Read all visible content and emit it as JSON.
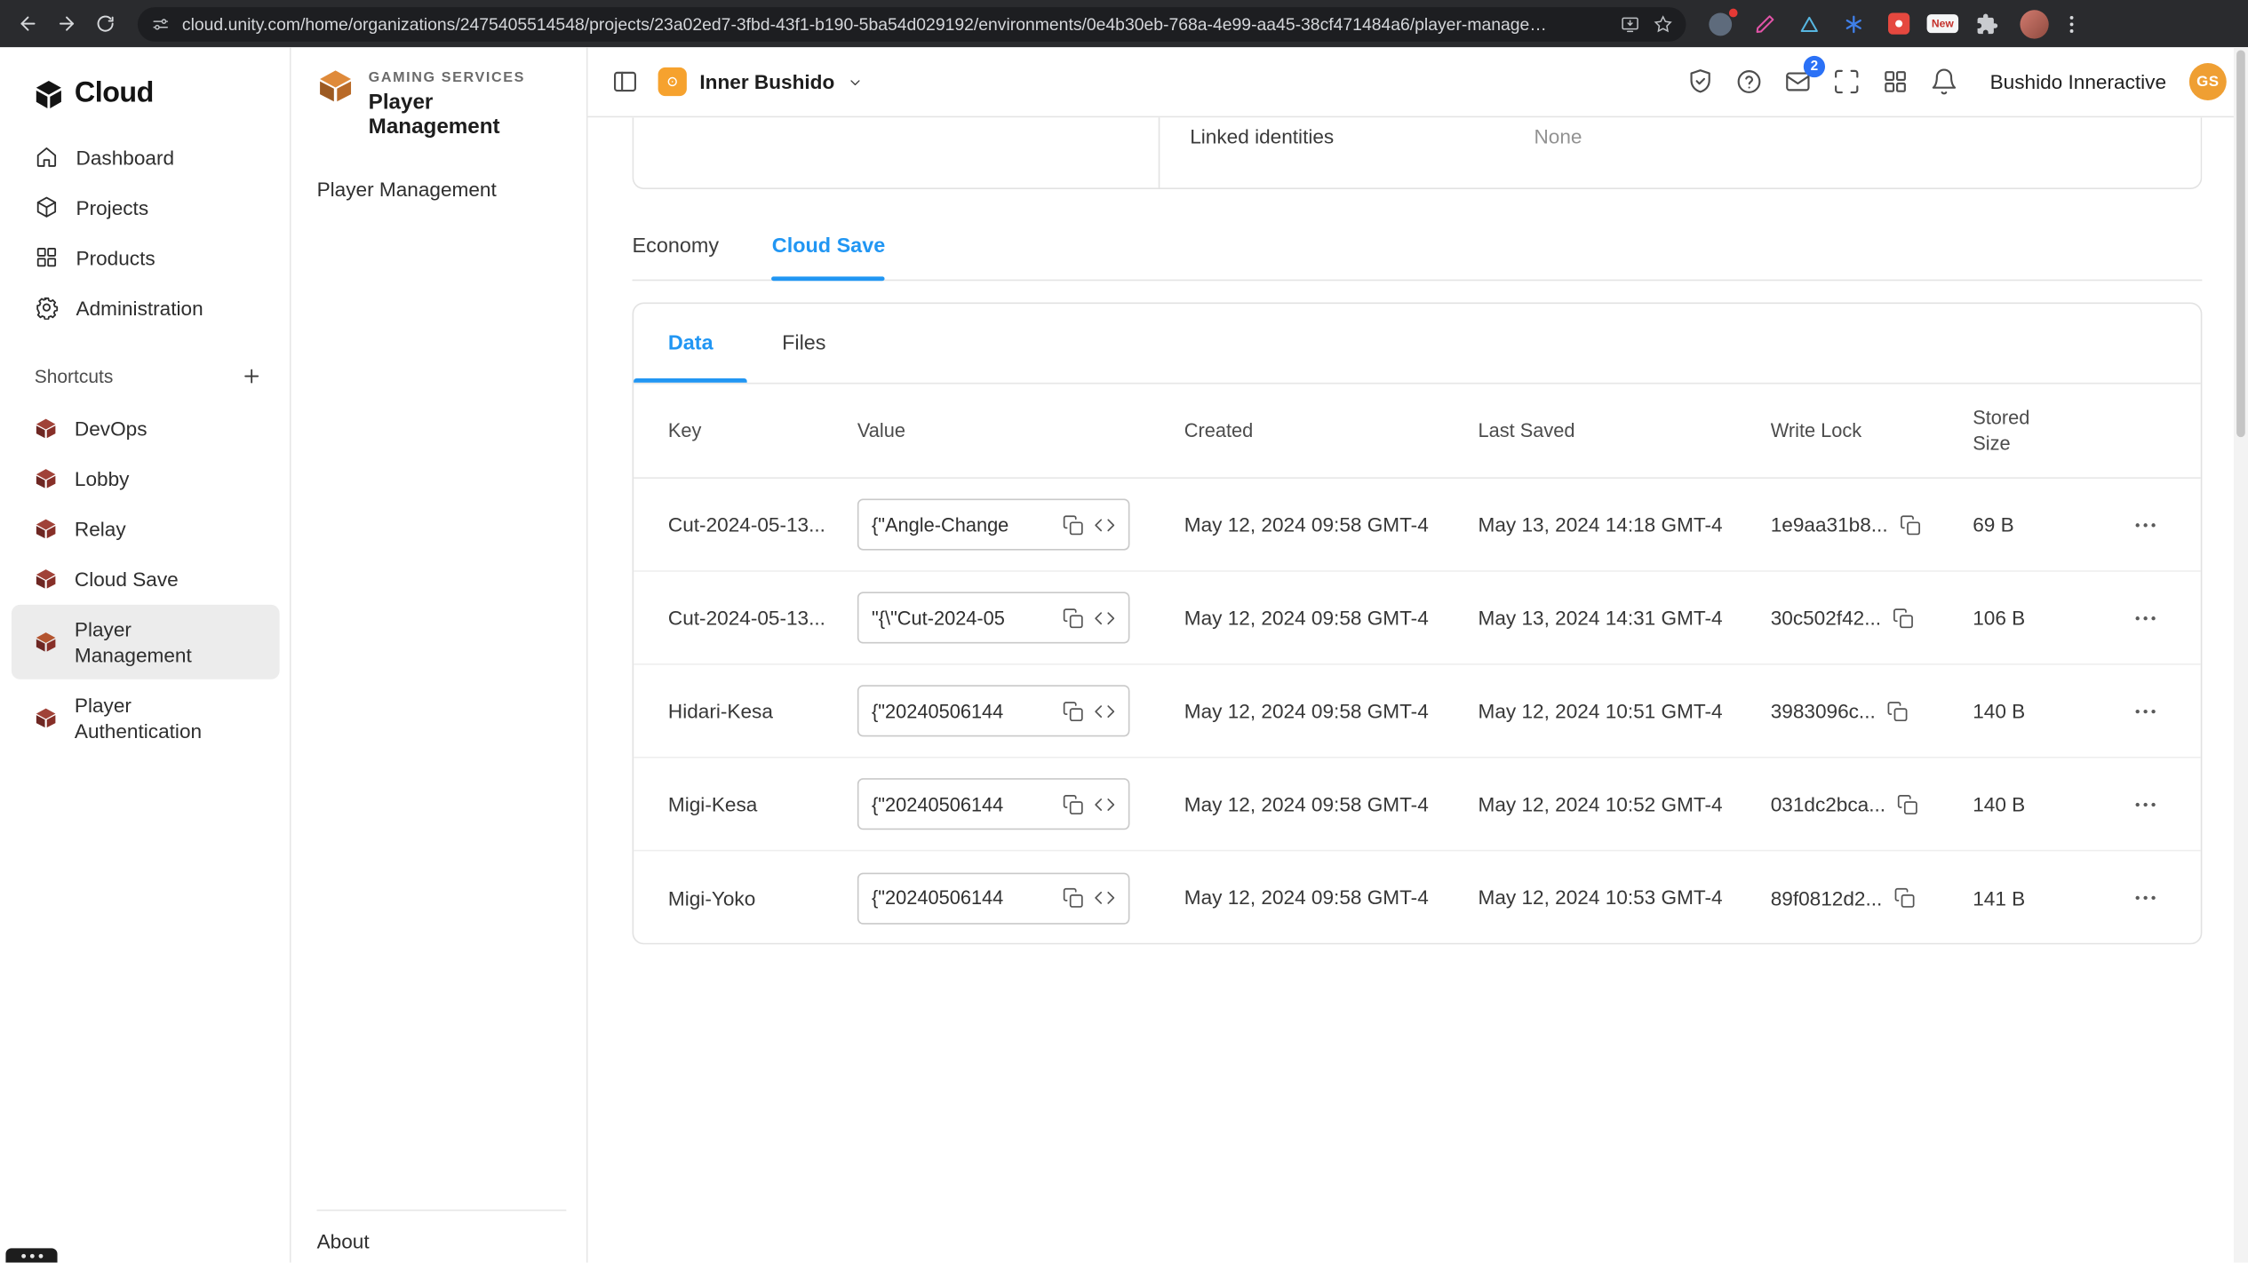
{
  "browser": {
    "url": "cloud.unity.com/home/organizations/2475405514548/projects/23a02ed7-3fbd-43f1-b190-5ba54d029192/environments/0e4b30eb-768a-4e99-aa45-38cf471484a6/player-manage…",
    "new_extension_label": "New"
  },
  "sidebar": {
    "logo_text": "Cloud",
    "items": [
      {
        "label": "Dashboard"
      },
      {
        "label": "Projects"
      },
      {
        "label": "Products"
      },
      {
        "label": "Administration"
      }
    ],
    "shortcuts_label": "Shortcuts",
    "shortcuts": [
      {
        "label": "DevOps"
      },
      {
        "label": "Lobby"
      },
      {
        "label": "Relay"
      },
      {
        "label": "Cloud Save"
      },
      {
        "label": "Player Management"
      },
      {
        "label": "Player Authentication"
      }
    ]
  },
  "service_panel": {
    "eyebrow": "GAMING SERVICES",
    "title": "Player Management",
    "nav_item": "Player Management",
    "about_label": "About"
  },
  "app_header": {
    "project_name": "Inner Bushido",
    "org_name": "Bushido Inneractive",
    "avatar_initials": "GS",
    "inbox_badge": "2"
  },
  "details": {
    "linked_identities_label": "Linked identities",
    "linked_identities_value": "None"
  },
  "tabs": {
    "economy": "Economy",
    "cloud_save": "Cloud Save"
  },
  "card_tabs": {
    "data": "Data",
    "files": "Files"
  },
  "table": {
    "columns": {
      "key": "Key",
      "value": "Value",
      "created": "Created",
      "last_saved": "Last Saved",
      "write_lock": "Write Lock",
      "stored_size": "Stored Size"
    },
    "rows": [
      {
        "key": "Cut-2024-05-13...",
        "value": "{\"Angle-Change",
        "created": "May 12, 2024 09:58 GMT-4",
        "last_saved": "May 13, 2024 14:18 GMT-4",
        "write_lock": "1e9aa31b8...",
        "stored_size": "69 B"
      },
      {
        "key": "Cut-2024-05-13...",
        "value": "\"{\\\"Cut-2024-05",
        "created": "May 12, 2024 09:58 GMT-4",
        "last_saved": "May 13, 2024 14:31 GMT-4",
        "write_lock": "30c502f42...",
        "stored_size": "106 B"
      },
      {
        "key": "Hidari-Kesa",
        "value": "{\"20240506144",
        "created": "May 12, 2024 09:58 GMT-4",
        "last_saved": "May 12, 2024 10:51 GMT-4",
        "write_lock": "3983096c...",
        "stored_size": "140 B"
      },
      {
        "key": "Migi-Kesa",
        "value": "{\"20240506144",
        "created": "May 12, 2024 09:58 GMT-4",
        "last_saved": "May 12, 2024 10:52 GMT-4",
        "write_lock": "031dc2bca...",
        "stored_size": "140 B"
      },
      {
        "key": "Migi-Yoko",
        "value": "{\"20240506144",
        "created": "May 12, 2024 09:58 GMT-4",
        "last_saved": "May 12, 2024 10:53 GMT-4",
        "write_lock": "89f0812d2...",
        "stored_size": "141 B"
      }
    ]
  },
  "colors": {
    "accent_blue": "#2196f3",
    "badge_blue": "#2b71f6",
    "project_orange": "#f6a22e"
  }
}
